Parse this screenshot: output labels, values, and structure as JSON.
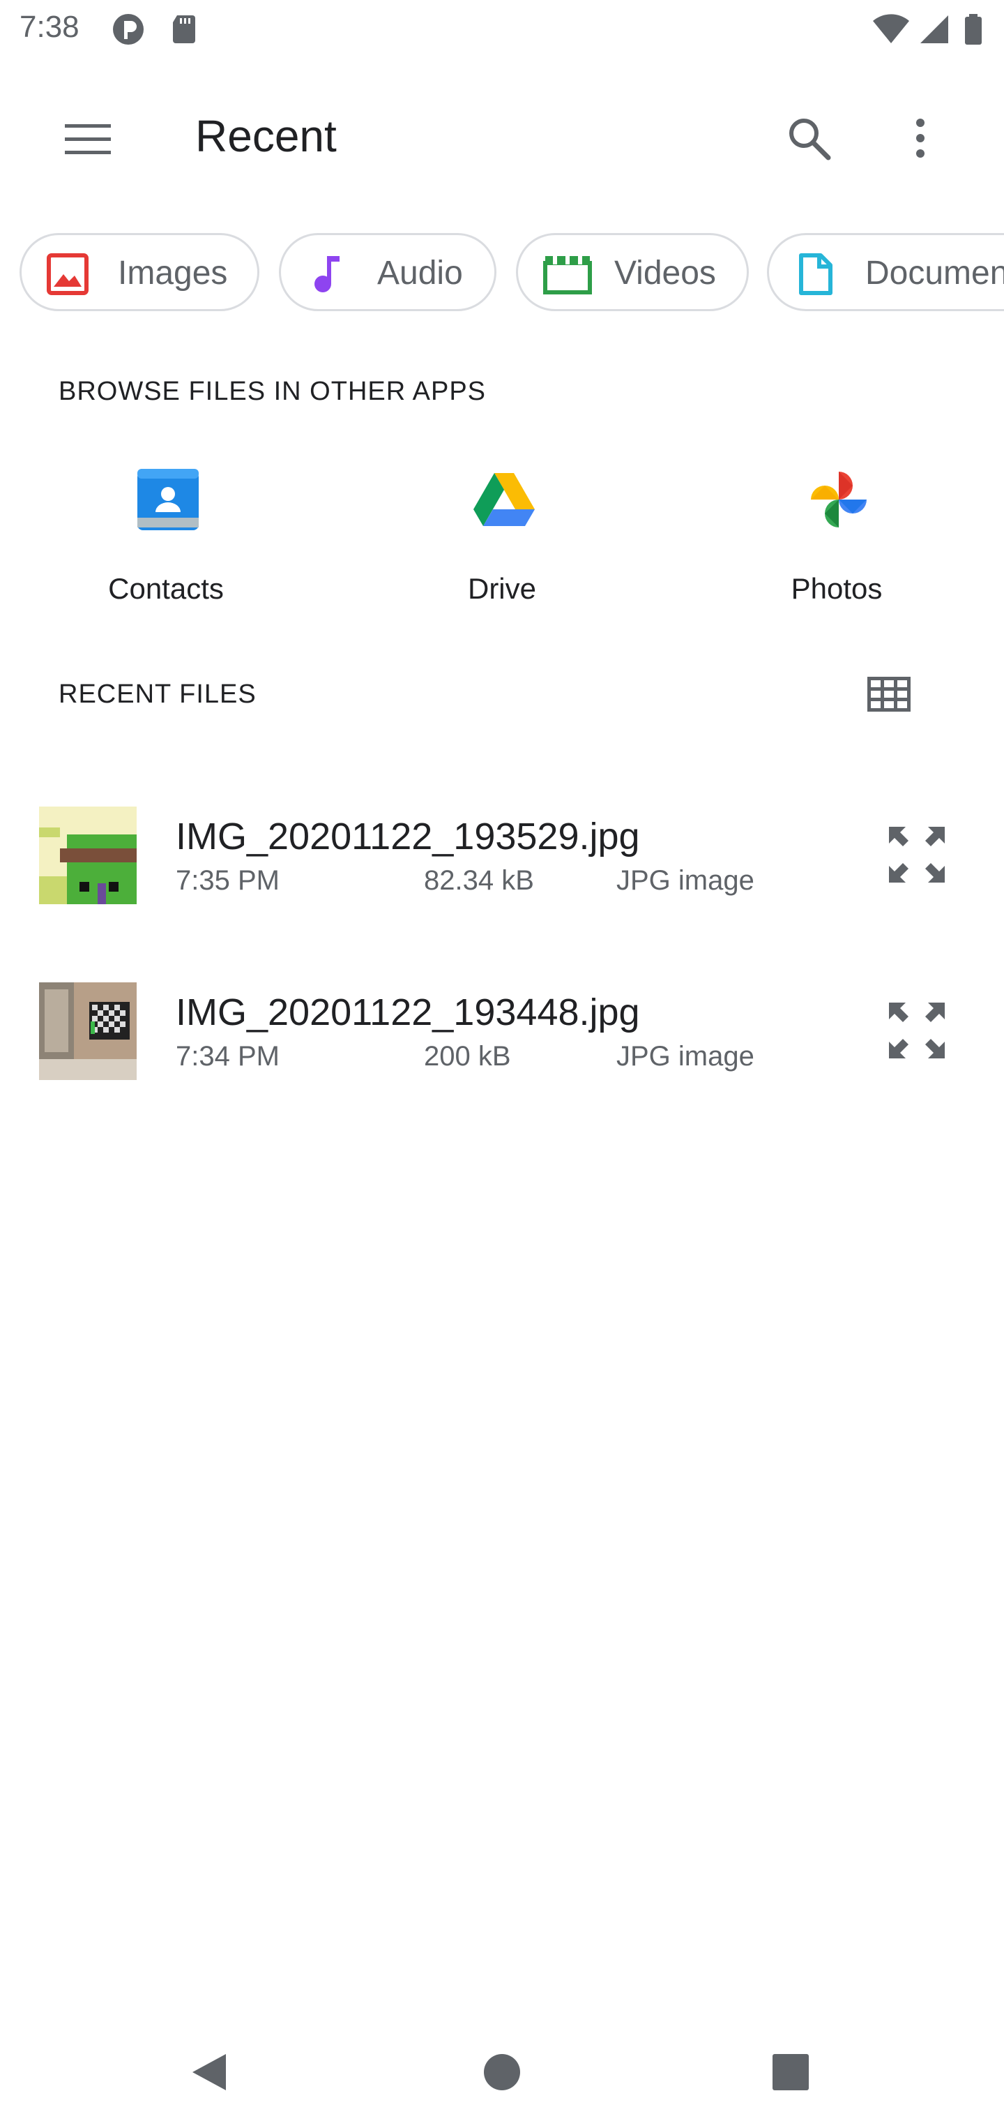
{
  "status_bar": {
    "time": "7:38"
  },
  "app_bar": {
    "title": "Recent",
    "menu_icon": "hamburger-menu-icon",
    "search_icon": "search-icon",
    "more_icon": "more-vert-icon"
  },
  "chips": [
    {
      "label": "Images",
      "icon": "image-icon",
      "color": "#e53935"
    },
    {
      "label": "Audio",
      "icon": "music-note-icon",
      "color": "#8e44f0"
    },
    {
      "label": "Videos",
      "icon": "movie-icon",
      "color": "#2e9e48"
    },
    {
      "label": "Documents",
      "icon": "document-icon",
      "color": "#26b5d8"
    }
  ],
  "browse_section": {
    "header": "BROWSE FILES IN OTHER APPS",
    "apps": [
      {
        "label": "Contacts",
        "icon": "contacts-icon"
      },
      {
        "label": "Drive",
        "icon": "drive-icon"
      },
      {
        "label": "Photos",
        "icon": "photos-icon"
      }
    ]
  },
  "recent_section": {
    "header": "RECENT FILES",
    "view_toggle_icon": "grid-view-icon",
    "files": [
      {
        "name": "IMG_20201122_193529.jpg",
        "time": "7:35 PM",
        "size": "82.34 kB",
        "type": "JPG image"
      },
      {
        "name": "IMG_20201122_193448.jpg",
        "time": "7:34 PM",
        "size": "200 kB",
        "type": "JPG image"
      }
    ]
  },
  "nav_bar": {
    "back_icon": "back-triangle-icon",
    "home_icon": "home-circle-icon",
    "recents_icon": "recents-square-icon"
  }
}
